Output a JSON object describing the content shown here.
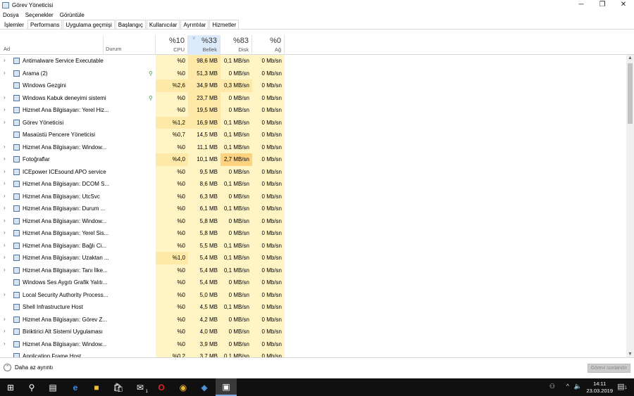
{
  "window": {
    "title": "Görev Yöneticisi",
    "minimize": "─",
    "restore": "❐",
    "close": "✕"
  },
  "menu": [
    "Dosya",
    "Seçenekler",
    "Görüntüle"
  ],
  "tabs": [
    "İşlemler",
    "Performans",
    "Uygulama geçmişi",
    "Başlangıç",
    "Kullanıcılar",
    "Ayrıntılar",
    "Hizmetler"
  ],
  "columns": {
    "name": "Ad",
    "status": "Durum",
    "cpu": {
      "pct": "%10",
      "label": "CPU"
    },
    "mem": {
      "pct": "%33",
      "label": "Bellek",
      "sort_arrow": "˅"
    },
    "disk": {
      "pct": "%83",
      "label": "Disk"
    },
    "net": {
      "pct": "%0",
      "label": "Ağ"
    }
  },
  "processes": [
    {
      "name": "Antimalware Service Executable",
      "exp": true,
      "cpu": "%0",
      "mem": "98,6 MB",
      "disk": "0,1 MB/sn",
      "net": "0 Mb/sn"
    },
    {
      "name": "Arama (2)",
      "exp": true,
      "leaf": true,
      "cpu": "%0",
      "mem": "51,3 MB",
      "disk": "0 MB/sn",
      "net": "0 Mb/sn"
    },
    {
      "name": "Windows Gezgini",
      "exp": false,
      "cpu": "%2,6",
      "mem": "34,9 MB",
      "disk": "0,3 MB/sn",
      "net": "0 Mb/sn"
    },
    {
      "name": "Windows Kabuk deneyimi sistemi",
      "exp": true,
      "leaf": true,
      "cpu": "%0",
      "mem": "23,7 MB",
      "disk": "0 MB/sn",
      "net": "0 Mb/sn"
    },
    {
      "name": "Hizmet Ana Bilgisayarı: Yerel Hiz...",
      "exp": true,
      "cpu": "%0",
      "mem": "19,5 MB",
      "disk": "0 MB/sn",
      "net": "0 Mb/sn"
    },
    {
      "name": "Görev Yöneticisi",
      "exp": true,
      "cpu": "%1,2",
      "mem": "16,9 MB",
      "disk": "0,1 MB/sn",
      "net": "0 Mb/sn"
    },
    {
      "name": "Masaüstü Pencere Yöneticisi",
      "exp": false,
      "cpu": "%0,7",
      "mem": "14,5 MB",
      "disk": "0,1 MB/sn",
      "net": "0 Mb/sn"
    },
    {
      "name": "Hizmet Ana Bilgisayarı: Window...",
      "exp": true,
      "cpu": "%0",
      "mem": "11,1 MB",
      "disk": "0,1 MB/sn",
      "net": "0 Mb/sn"
    },
    {
      "name": "Fotoğraflar",
      "exp": true,
      "cpu": "%4,0",
      "mem": "10,1 MB",
      "disk": "2,7 MB/sn",
      "net": "0 Mb/sn"
    },
    {
      "name": "ICEpower ICEsound APO service",
      "exp": true,
      "cpu": "%0",
      "mem": "9,5 MB",
      "disk": "0 MB/sn",
      "net": "0 Mb/sn"
    },
    {
      "name": "Hizmet Ana Bilgisayarı: DCOM S...",
      "exp": true,
      "cpu": "%0",
      "mem": "8,6 MB",
      "disk": "0,1 MB/sn",
      "net": "0 Mb/sn"
    },
    {
      "name": "Hizmet Ana Bilgisayarı: UtcSvc",
      "exp": true,
      "cpu": "%0",
      "mem": "6,3 MB",
      "disk": "0 MB/sn",
      "net": "0 Mb/sn"
    },
    {
      "name": "Hizmet Ana Bilgisayarı: Durum ...",
      "exp": true,
      "cpu": "%0",
      "mem": "6,1 MB",
      "disk": "0,1 MB/sn",
      "net": "0 Mb/sn"
    },
    {
      "name": "Hizmet Ana Bilgisayarı: Window...",
      "exp": true,
      "cpu": "%0",
      "mem": "5,8 MB",
      "disk": "0 MB/sn",
      "net": "0 Mb/sn"
    },
    {
      "name": "Hizmet Ana Bilgisayarı: Yerel Sis...",
      "exp": true,
      "cpu": "%0",
      "mem": "5,8 MB",
      "disk": "0 MB/sn",
      "net": "0 Mb/sn"
    },
    {
      "name": "Hizmet Ana Bilgisayarı: Bağlı Ci...",
      "exp": true,
      "cpu": "%0",
      "mem": "5,5 MB",
      "disk": "0,1 MB/sn",
      "net": "0 Mb/sn"
    },
    {
      "name": "Hizmet Ana Bilgisayarı: Uzaktan ...",
      "exp": true,
      "cpu": "%1,0",
      "mem": "5,4 MB",
      "disk": "0,1 MB/sn",
      "net": "0 Mb/sn"
    },
    {
      "name": "Hizmet Ana Bilgisayarı: Tanı İlke...",
      "exp": true,
      "cpu": "%0",
      "mem": "5,4 MB",
      "disk": "0,1 MB/sn",
      "net": "0 Mb/sn"
    },
    {
      "name": "Windows Ses Aygıtı Grafik Yalıtı...",
      "exp": false,
      "cpu": "%0",
      "mem": "5,4 MB",
      "disk": "0 MB/sn",
      "net": "0 Mb/sn"
    },
    {
      "name": "Local Security Authority Process...",
      "exp": true,
      "cpu": "%0",
      "mem": "5,0 MB",
      "disk": "0 MB/sn",
      "net": "0 Mb/sn"
    },
    {
      "name": "Shell Infrastructure Host",
      "exp": false,
      "cpu": "%0",
      "mem": "4,5 MB",
      "disk": "0,1 MB/sn",
      "net": "0 Mb/sn"
    },
    {
      "name": "Hizmet Ana Bilgisayarı: Görev Z...",
      "exp": true,
      "cpu": "%0",
      "mem": "4,2 MB",
      "disk": "0 MB/sn",
      "net": "0 Mb/sn"
    },
    {
      "name": "Biriktirici Alt Sistemi Uygulaması",
      "exp": true,
      "cpu": "%0",
      "mem": "4,0 MB",
      "disk": "0 MB/sn",
      "net": "0 Mb/sn"
    },
    {
      "name": "Hizmet Ana Bilgisayarı: Window...",
      "exp": true,
      "cpu": "%0",
      "mem": "3,9 MB",
      "disk": "0 MB/sn",
      "net": "0 Mb/sn"
    },
    {
      "name": "Application Frame Host",
      "exp": false,
      "cpu": "%0,2",
      "mem": "3,7 MB",
      "disk": "0,1 MB/sn",
      "net": "0 Mb/sn"
    }
  ],
  "footer": {
    "less_details": "Daha az ayrıntı",
    "end_task": "Görevi sonlandır"
  },
  "taskbar": {
    "time": "14:11",
    "date": "23.03.2019",
    "mail_badge": "1",
    "notif_badge": "1"
  },
  "colors": {
    "heat_low": "#fff4c4",
    "heat_mid": "#ffe9a8",
    "heat_high": "#ffd27f",
    "sorted_header": "#dcebfb"
  }
}
